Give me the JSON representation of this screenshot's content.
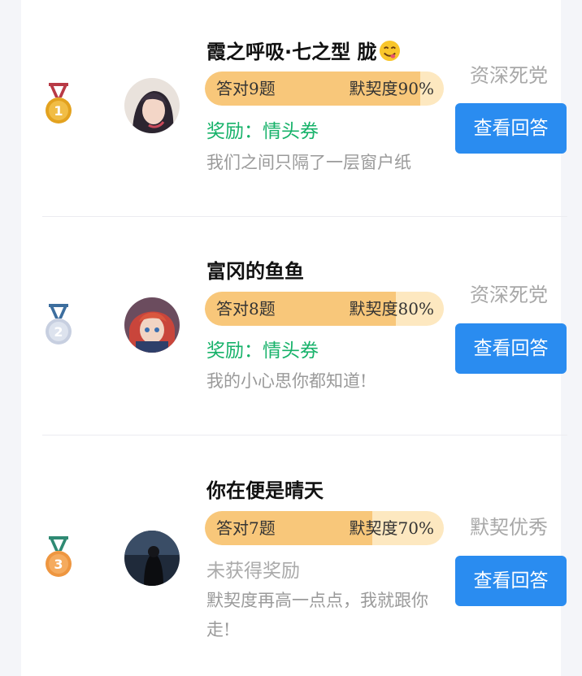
{
  "entries": [
    {
      "rank": "1",
      "name": "霞之呼吸·七之型 胧",
      "answered": "答对9题",
      "tacit": "默契度90%",
      "tacit_value": 0.9,
      "reward": "奖励：情头券",
      "message": "我们之间只隔了一层窗户纸",
      "level": "资深死党",
      "button": "查看回答",
      "medal_color": "#e3a21f",
      "ribbon_color": "#b83a46"
    },
    {
      "rank": "2",
      "name": "富冈的鱼鱼",
      "answered": "答对8题",
      "tacit": "默契度80%",
      "tacit_value": 0.8,
      "reward": "奖励：情头券",
      "message": "我的小心思你都知道!",
      "level": "资深死党",
      "button": "查看回答",
      "medal_color": "#c7cfe0",
      "ribbon_color": "#3d6e9e"
    },
    {
      "rank": "3",
      "name": "你在便是晴天",
      "answered": "答对7题",
      "tacit": "默契度70%",
      "tacit_value": 0.7,
      "reward": "未获得奖励",
      "message": "默契度再高一点点，我就跟你走!",
      "level": "默契优秀",
      "button": "查看回答",
      "medal_color": "#ee9640",
      "ribbon_color": "#2f8a73"
    }
  ]
}
